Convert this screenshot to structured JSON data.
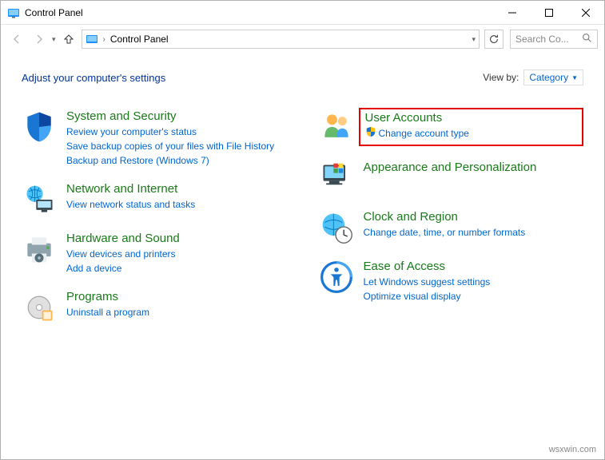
{
  "window": {
    "title": "Control Panel"
  },
  "address": {
    "location": "Control Panel"
  },
  "search": {
    "placeholder": "Search Co..."
  },
  "header": {
    "title": "Adjust your computer's settings",
    "view_by_label": "View by:",
    "view_by_value": "Category"
  },
  "left_col": [
    {
      "title": "System and Security",
      "links": [
        "Review your computer's status",
        "Save backup copies of your files with File History",
        "Backup and Restore (Windows 7)"
      ]
    },
    {
      "title": "Network and Internet",
      "links": [
        "View network status and tasks"
      ]
    },
    {
      "title": "Hardware and Sound",
      "links": [
        "View devices and printers",
        "Add a device"
      ]
    },
    {
      "title": "Programs",
      "links": [
        "Uninstall a program"
      ]
    }
  ],
  "right_col": [
    {
      "title": "User Accounts",
      "links": [
        "Change account type"
      ],
      "highlighted": true,
      "shield_on_link": true
    },
    {
      "title": "Appearance and Personalization",
      "links": []
    },
    {
      "title": "Clock and Region",
      "links": [
        "Change date, time, or number formats"
      ]
    },
    {
      "title": "Ease of Access",
      "links": [
        "Let Windows suggest settings",
        "Optimize visual display"
      ]
    }
  ],
  "watermark": "wsxwin.com"
}
